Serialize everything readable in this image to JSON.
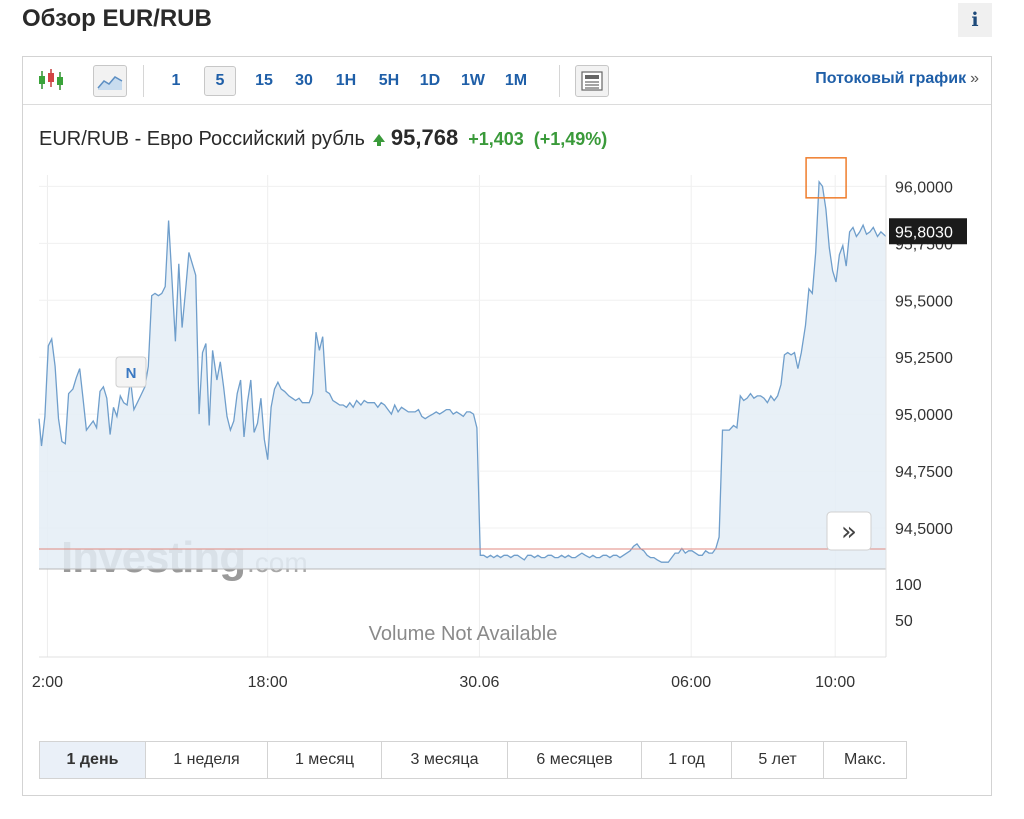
{
  "page": {
    "title": "Обзор EUR/RUB",
    "info_label": "i"
  },
  "toolbar": {
    "intervals": [
      {
        "label": "1"
      },
      {
        "label": "5",
        "active": true
      },
      {
        "label": "15"
      },
      {
        "label": "30"
      },
      {
        "label": "1H"
      },
      {
        "label": "5H"
      },
      {
        "label": "1D"
      },
      {
        "label": "1W"
      },
      {
        "label": "1M"
      }
    ],
    "stream_label": "Потоковый график",
    "stream_arrow": "»"
  },
  "quote": {
    "name": "EUR/RUB - Евро Российский рубль",
    "price": "95,768",
    "change": "+1,403",
    "change_pct": "(+1,49%)",
    "up_color": "#3a9a3a"
  },
  "chart_data": {
    "type": "area",
    "y_ticks": [
      96.0,
      95.75,
      95.5,
      95.25,
      95.0,
      94.75,
      94.5
    ],
    "y_tick_labels": [
      "96,0000",
      "95,7500",
      "95,5000",
      "95,2500",
      "95,0000",
      "94,7500",
      "94,5000"
    ],
    "ylim": [
      94.32,
      96.05
    ],
    "x_tick_labels": [
      "2:00",
      "18:00",
      "30.06",
      "06:00",
      "10:00"
    ],
    "x_tick_positions": [
      0.01,
      0.27,
      0.52,
      0.77,
      0.94
    ],
    "current_value": 95.803,
    "current_value_label": "95,8030",
    "volume_labels": [
      "100",
      "50"
    ],
    "volume_note": "Volume Not Available",
    "watermark_main": "Investing",
    "watermark_sub": ".com",
    "news_marker": "N",
    "scroll_button": "»",
    "line_color": "#6f9ecb",
    "fill_color": "#e4edf6",
    "reference_line_color": "#e08a80",
    "highlight_color": "#ef7d2c",
    "series": [
      {
        "values": [
          [
            0.0,
            94.98
          ],
          [
            0.003,
            94.86
          ],
          [
            0.007,
            94.99
          ],
          [
            0.011,
            95.3
          ],
          [
            0.015,
            95.33
          ],
          [
            0.019,
            95.21
          ],
          [
            0.023,
            94.98
          ],
          [
            0.027,
            94.88
          ],
          [
            0.031,
            94.87
          ],
          [
            0.035,
            95.09
          ],
          [
            0.04,
            95.11
          ],
          [
            0.044,
            95.16
          ],
          [
            0.048,
            95.2
          ],
          [
            0.052,
            95.07
          ],
          [
            0.056,
            94.93
          ],
          [
            0.06,
            94.95
          ],
          [
            0.064,
            94.97
          ],
          [
            0.068,
            94.94
          ],
          [
            0.072,
            95.1
          ],
          [
            0.076,
            95.12
          ],
          [
            0.08,
            95.07
          ],
          [
            0.084,
            94.91
          ],
          [
            0.088,
            95.03
          ],
          [
            0.092,
            94.99
          ],
          [
            0.096,
            95.08
          ],
          [
            0.1,
            95.05
          ],
          [
            0.104,
            95.04
          ],
          [
            0.108,
            95.15
          ],
          [
            0.112,
            95.02
          ],
          [
            0.116,
            95.05
          ],
          [
            0.12,
            95.08
          ],
          [
            0.125,
            95.12
          ],
          [
            0.129,
            95.21
          ],
          [
            0.133,
            95.52
          ],
          [
            0.137,
            95.53
          ],
          [
            0.141,
            95.52
          ],
          [
            0.145,
            95.53
          ],
          [
            0.149,
            95.56
          ],
          [
            0.153,
            95.85
          ],
          [
            0.157,
            95.59
          ],
          [
            0.161,
            95.32
          ],
          [
            0.165,
            95.66
          ],
          [
            0.169,
            95.38
          ],
          [
            0.173,
            95.54
          ],
          [
            0.177,
            95.71
          ],
          [
            0.181,
            95.66
          ],
          [
            0.185,
            95.61
          ],
          [
            0.189,
            95.0
          ],
          [
            0.193,
            95.27
          ],
          [
            0.197,
            95.31
          ],
          [
            0.201,
            94.95
          ],
          [
            0.205,
            95.28
          ],
          [
            0.21,
            95.15
          ],
          [
            0.214,
            95.23
          ],
          [
            0.218,
            95.12
          ],
          [
            0.222,
            94.99
          ],
          [
            0.226,
            94.93
          ],
          [
            0.23,
            94.97
          ],
          [
            0.234,
            95.09
          ],
          [
            0.238,
            95.15
          ],
          [
            0.242,
            94.9
          ],
          [
            0.246,
            95.05
          ],
          [
            0.25,
            95.15
          ],
          [
            0.254,
            94.92
          ],
          [
            0.258,
            94.96
          ],
          [
            0.262,
            95.07
          ],
          [
            0.266,
            94.89
          ],
          [
            0.27,
            94.8
          ],
          [
            0.274,
            95.03
          ],
          [
            0.278,
            95.11
          ],
          [
            0.282,
            95.14
          ],
          [
            0.286,
            95.11
          ],
          [
            0.29,
            95.1
          ],
          [
            0.295,
            95.08
          ],
          [
            0.299,
            95.07
          ],
          [
            0.303,
            95.06
          ],
          [
            0.307,
            95.07
          ],
          [
            0.311,
            95.05
          ],
          [
            0.315,
            95.05
          ],
          [
            0.319,
            95.05
          ],
          [
            0.323,
            95.09
          ],
          [
            0.327,
            95.36
          ],
          [
            0.331,
            95.28
          ],
          [
            0.335,
            95.34
          ],
          [
            0.339,
            95.1
          ],
          [
            0.343,
            95.09
          ],
          [
            0.347,
            95.06
          ],
          [
            0.351,
            95.05
          ],
          [
            0.355,
            95.04
          ],
          [
            0.359,
            95.04
          ],
          [
            0.363,
            95.03
          ],
          [
            0.367,
            95.05
          ],
          [
            0.371,
            95.03
          ],
          [
            0.375,
            95.06
          ],
          [
            0.38,
            95.04
          ],
          [
            0.384,
            95.06
          ],
          [
            0.388,
            95.05
          ],
          [
            0.392,
            95.05
          ],
          [
            0.396,
            95.05
          ],
          [
            0.4,
            95.03
          ],
          [
            0.404,
            95.05
          ],
          [
            0.408,
            95.04
          ],
          [
            0.412,
            95.02
          ],
          [
            0.416,
            95.0
          ],
          [
            0.42,
            95.04
          ],
          [
            0.424,
            95.01
          ],
          [
            0.428,
            95.03
          ],
          [
            0.432,
            95.02
          ],
          [
            0.436,
            95.01
          ],
          [
            0.44,
            95.01
          ],
          [
            0.444,
            95.01
          ],
          [
            0.448,
            95.02
          ],
          [
            0.452,
            94.99
          ],
          [
            0.456,
            94.98
          ],
          [
            0.46,
            94.99
          ],
          [
            0.465,
            95.0
          ],
          [
            0.469,
            95.01
          ],
          [
            0.473,
            95.0
          ],
          [
            0.477,
            95.01
          ],
          [
            0.481,
            95.02
          ],
          [
            0.485,
            95.02
          ],
          [
            0.489,
            95.0
          ],
          [
            0.493,
            95.01
          ],
          [
            0.497,
            95.0
          ],
          [
            0.501,
            94.99
          ],
          [
            0.505,
            95.01
          ],
          [
            0.509,
            95.01
          ],
          [
            0.513,
            95.0
          ],
          [
            0.517,
            94.94
          ],
          [
            0.521,
            94.38
          ],
          [
            0.525,
            94.38
          ],
          [
            0.529,
            94.37
          ],
          [
            0.533,
            94.38
          ],
          [
            0.537,
            94.37
          ],
          [
            0.541,
            94.38
          ],
          [
            0.545,
            94.37
          ],
          [
            0.549,
            94.38
          ],
          [
            0.553,
            94.38
          ],
          [
            0.557,
            94.37
          ],
          [
            0.561,
            94.38
          ],
          [
            0.565,
            94.38
          ],
          [
            0.569,
            94.37
          ],
          [
            0.573,
            94.36
          ],
          [
            0.577,
            94.38
          ],
          [
            0.581,
            94.38
          ],
          [
            0.585,
            94.37
          ],
          [
            0.589,
            94.38
          ],
          [
            0.593,
            94.37
          ],
          [
            0.597,
            94.37
          ],
          [
            0.601,
            94.38
          ],
          [
            0.605,
            94.38
          ],
          [
            0.609,
            94.37
          ],
          [
            0.613,
            94.37
          ],
          [
            0.617,
            94.38
          ],
          [
            0.621,
            94.37
          ],
          [
            0.625,
            94.38
          ],
          [
            0.629,
            94.37
          ],
          [
            0.633,
            94.37
          ],
          [
            0.637,
            94.38
          ],
          [
            0.641,
            94.39
          ],
          [
            0.645,
            94.38
          ],
          [
            0.65,
            94.37
          ],
          [
            0.654,
            94.38
          ],
          [
            0.658,
            94.37
          ],
          [
            0.662,
            94.37
          ],
          [
            0.666,
            94.38
          ],
          [
            0.67,
            94.38
          ],
          [
            0.674,
            94.37
          ],
          [
            0.678,
            94.38
          ],
          [
            0.682,
            94.38
          ],
          [
            0.686,
            94.37
          ],
          [
            0.69,
            94.38
          ],
          [
            0.694,
            94.39
          ],
          [
            0.698,
            94.4
          ],
          [
            0.702,
            94.42
          ],
          [
            0.706,
            94.43
          ],
          [
            0.71,
            94.41
          ],
          [
            0.714,
            94.4
          ],
          [
            0.718,
            94.38
          ],
          [
            0.722,
            94.37
          ],
          [
            0.726,
            94.37
          ],
          [
            0.73,
            94.36
          ],
          [
            0.735,
            94.35
          ],
          [
            0.739,
            94.35
          ],
          [
            0.743,
            94.35
          ],
          [
            0.747,
            94.37
          ],
          [
            0.751,
            94.39
          ],
          [
            0.755,
            94.39
          ],
          [
            0.759,
            94.41
          ],
          [
            0.763,
            94.39
          ],
          [
            0.767,
            94.4
          ],
          [
            0.771,
            94.4
          ],
          [
            0.775,
            94.39
          ],
          [
            0.779,
            94.38
          ],
          [
            0.783,
            94.38
          ],
          [
            0.787,
            94.4
          ],
          [
            0.791,
            94.39
          ],
          [
            0.795,
            94.39
          ],
          [
            0.799,
            94.41
          ],
          [
            0.803,
            94.46
          ],
          [
            0.807,
            94.93
          ],
          [
            0.811,
            94.93
          ],
          [
            0.815,
            94.93
          ],
          [
            0.82,
            94.95
          ],
          [
            0.824,
            94.94
          ],
          [
            0.828,
            95.08
          ],
          [
            0.832,
            95.06
          ],
          [
            0.836,
            95.07
          ],
          [
            0.84,
            95.09
          ],
          [
            0.844,
            95.07
          ],
          [
            0.848,
            95.08
          ],
          [
            0.852,
            95.08
          ],
          [
            0.856,
            95.07
          ],
          [
            0.86,
            95.05
          ],
          [
            0.864,
            95.08
          ],
          [
            0.868,
            95.06
          ],
          [
            0.872,
            95.08
          ],
          [
            0.876,
            95.13
          ],
          [
            0.88,
            95.26
          ],
          [
            0.884,
            95.27
          ],
          [
            0.888,
            95.26
          ],
          [
            0.892,
            95.27
          ],
          [
            0.896,
            95.2
          ],
          [
            0.9,
            95.27
          ],
          [
            0.905,
            95.39
          ],
          [
            0.909,
            95.55
          ],
          [
            0.913,
            95.53
          ],
          [
            0.917,
            95.71
          ],
          [
            0.921,
            96.02
          ],
          [
            0.925,
            96.0
          ],
          [
            0.929,
            95.9
          ],
          [
            0.933,
            95.73
          ],
          [
            0.937,
            95.63
          ],
          [
            0.941,
            95.58
          ],
          [
            0.945,
            95.7
          ],
          [
            0.949,
            95.74
          ],
          [
            0.953,
            95.65
          ],
          [
            0.957,
            95.8
          ],
          [
            0.961,
            95.82
          ],
          [
            0.965,
            95.78
          ],
          [
            0.969,
            95.8
          ],
          [
            0.973,
            95.83
          ],
          [
            0.977,
            95.79
          ],
          [
            0.981,
            95.8
          ],
          [
            0.985,
            95.82
          ],
          [
            0.99,
            95.78
          ],
          [
            0.994,
            95.8
          ],
          [
            1.0,
            95.78
          ]
        ]
      }
    ]
  },
  "ranges": [
    {
      "label": "1 день",
      "active": true
    },
    {
      "label": "1 неделя"
    },
    {
      "label": "1 месяц"
    },
    {
      "label": "3 месяца"
    },
    {
      "label": "6 месяцев"
    },
    {
      "label": "1 год"
    },
    {
      "label": "5 лет"
    },
    {
      "label": "Макс."
    }
  ]
}
